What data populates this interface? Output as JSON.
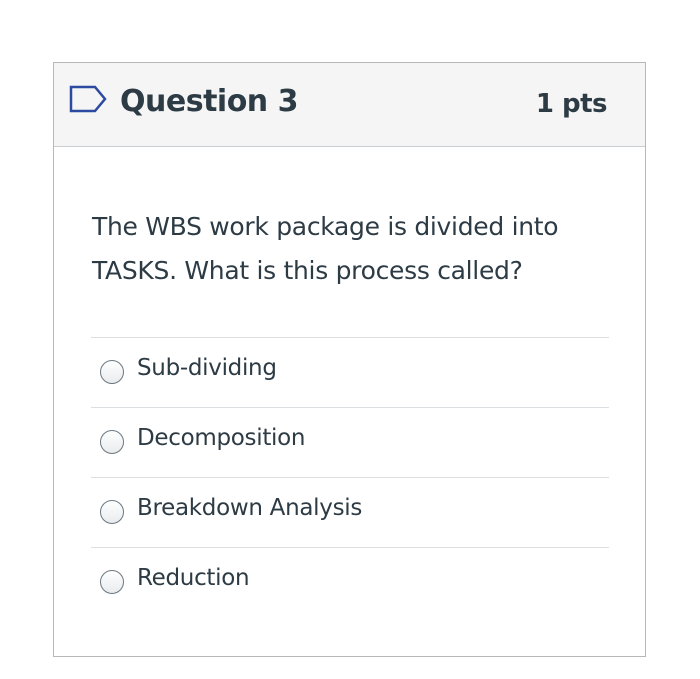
{
  "question": {
    "title": "Question 3",
    "points": "1 pts",
    "text": "The WBS work package is divided into TASKS. What is this process called?",
    "flag_icon": "bookmark-flag-icon"
  },
  "answers": [
    {
      "label": "Sub-dividing",
      "selected": false
    },
    {
      "label": "Decomposition",
      "selected": false
    },
    {
      "label": "Breakdown Analysis",
      "selected": false
    },
    {
      "label": "Reduction",
      "selected": false
    }
  ],
  "colors": {
    "header_bg": "#f5f5f5",
    "text": "#2d3b45",
    "flag": "#2c4aa0"
  }
}
